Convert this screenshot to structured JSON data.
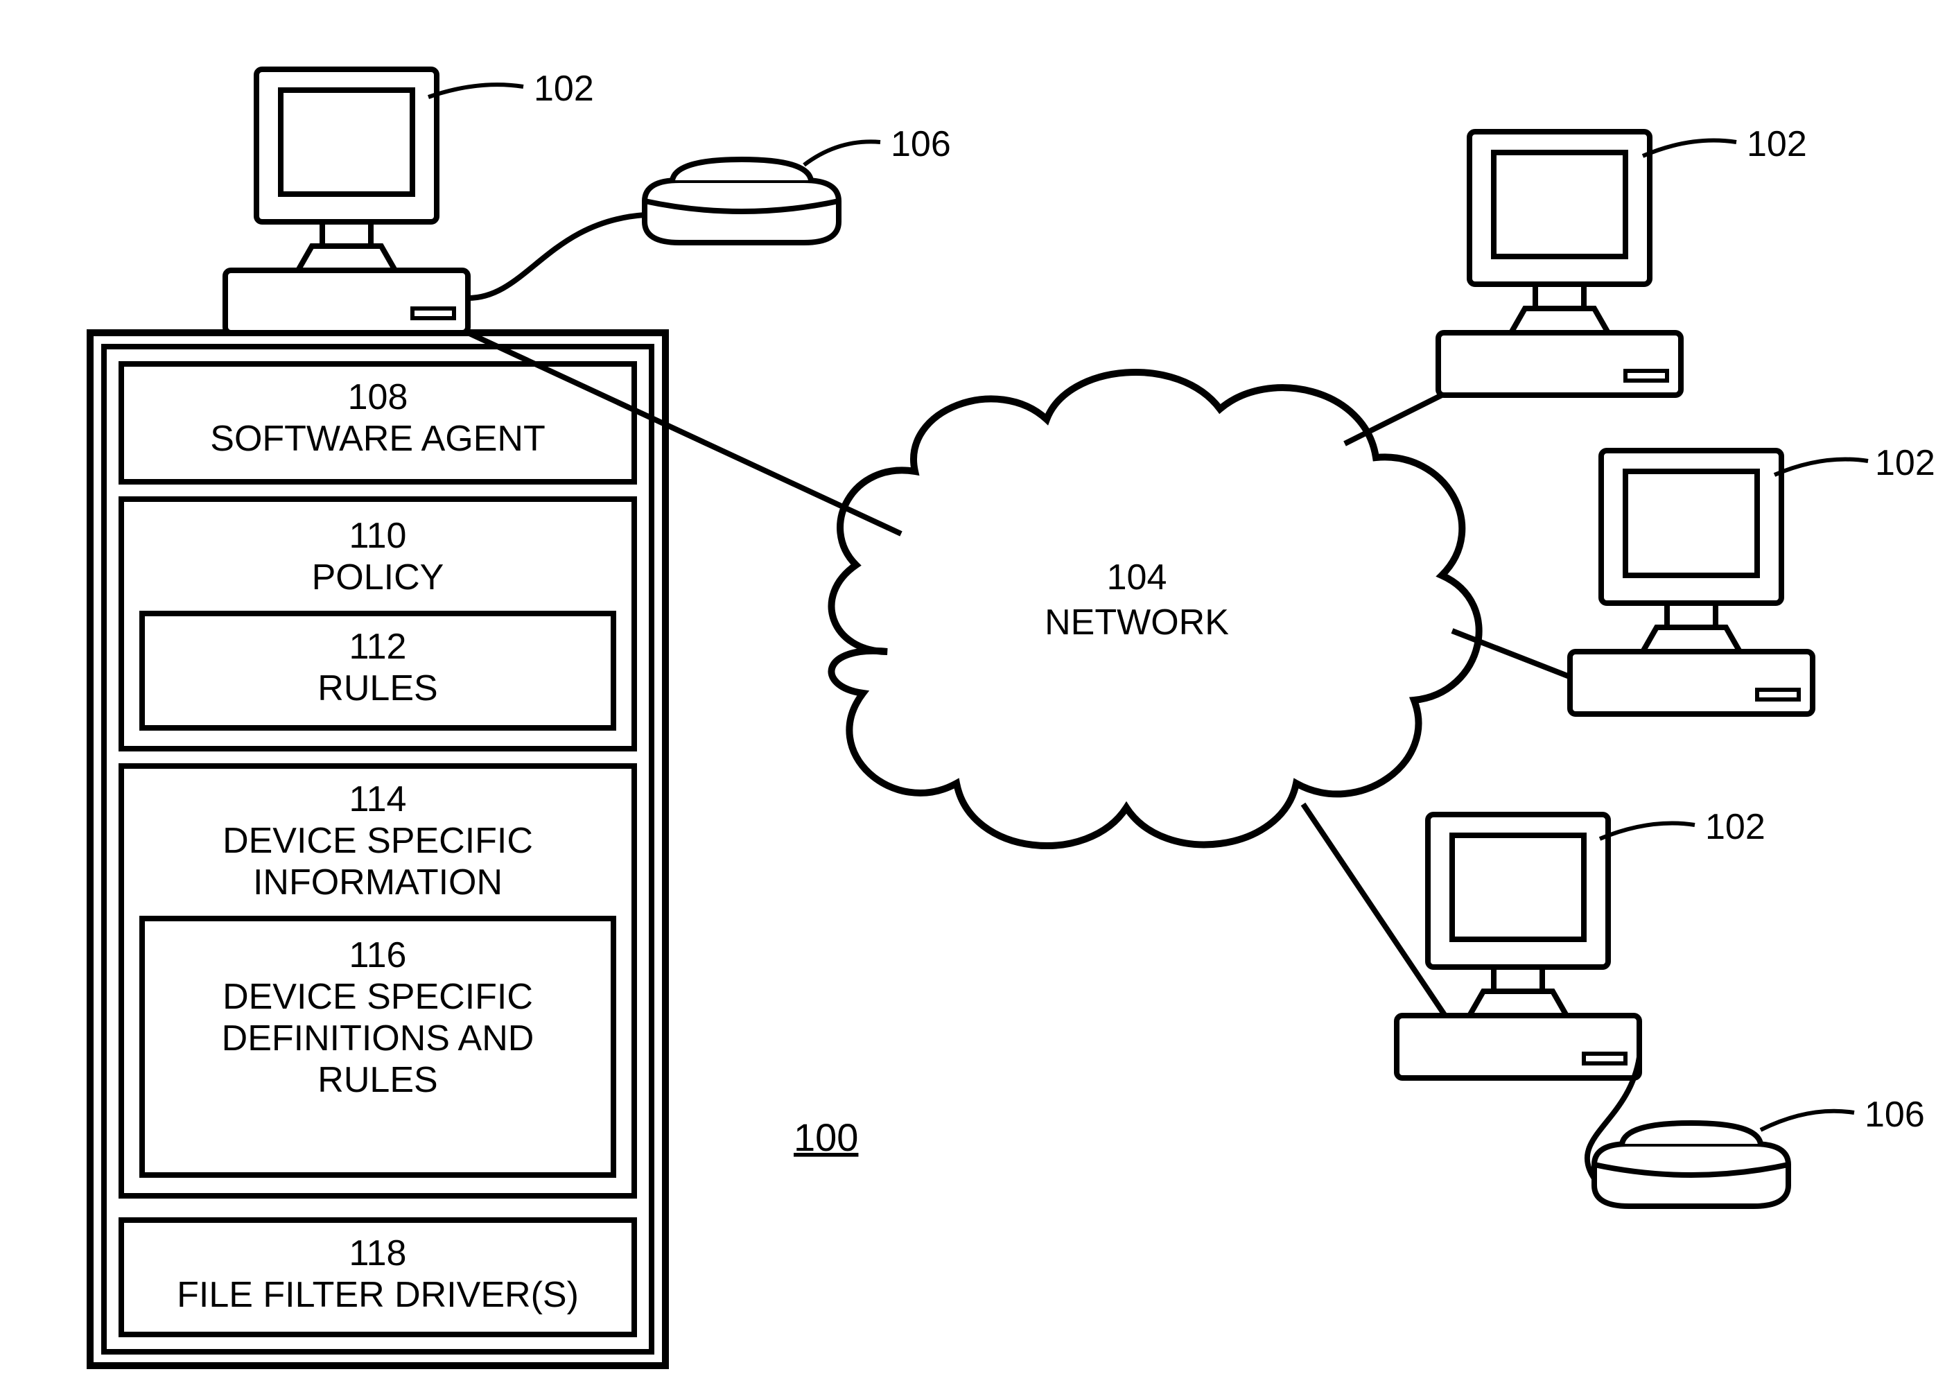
{
  "figure_number": "100",
  "cloud": {
    "ref": "104",
    "label": "NETWORK"
  },
  "boxes": {
    "software_agent": {
      "ref": "108",
      "label": "SOFTWARE AGENT"
    },
    "policy": {
      "ref": "110",
      "label": "POLICY"
    },
    "rules": {
      "ref": "112",
      "label": "RULES"
    },
    "dev_info": {
      "ref": "114",
      "label": "DEVICE SPECIFIC INFORMATION"
    },
    "dev_defs": {
      "ref": "116",
      "label": "DEVICE SPECIFIC DEFINITIONS AND RULES"
    },
    "ffd": {
      "ref": "118",
      "label": "FILE FILTER DRIVER(S)"
    }
  },
  "refs": {
    "computer": "102",
    "peripheral": "106"
  }
}
